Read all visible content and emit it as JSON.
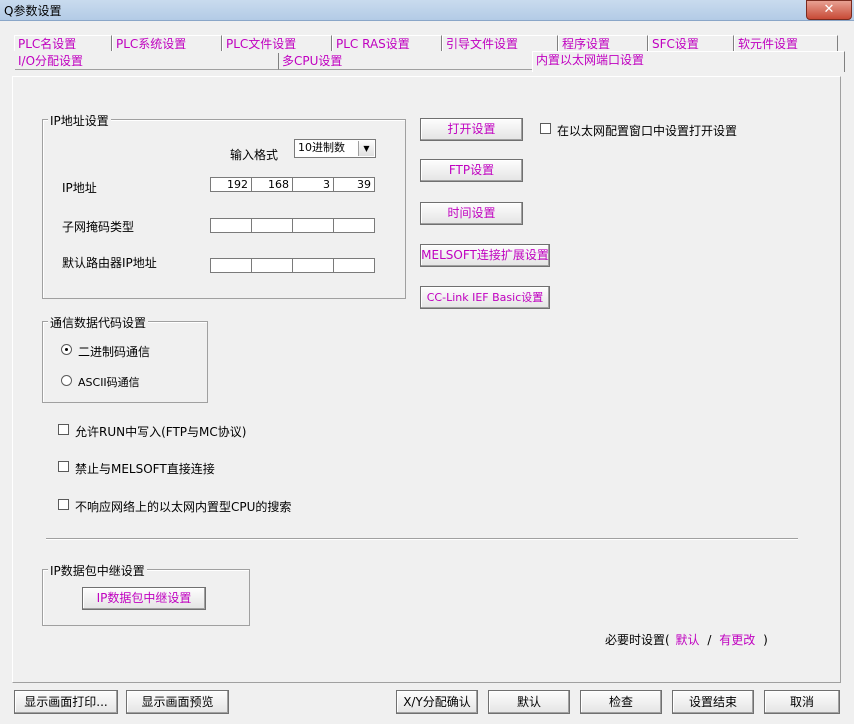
{
  "window": {
    "title": "Q参数设置",
    "close_glyph": "✕"
  },
  "tabs_row1": [
    "PLC名设置",
    "PLC系统设置",
    "PLC文件设置",
    "PLC RAS设置",
    "引导文件设置",
    "程序设置",
    "SFC设置",
    "软元件设置"
  ],
  "tabs_row2": [
    "I/O分配设置",
    "多CPU设置",
    "内置以太网端口设置"
  ],
  "ip_group": {
    "label": "IP地址设置",
    "input_format_label": "输入格式",
    "input_format_value": "10进制数",
    "ip_label": "IP地址",
    "ip": [
      "192",
      "168",
      "3",
      "39"
    ],
    "subnet_label": "子网掩码类型",
    "gateway_label": "默认路由器IP地址"
  },
  "side_buttons": {
    "open": "打开设置",
    "open_check": "在以太网配置窗口中设置打开设置",
    "ftp": "FTP设置",
    "time": "时间设置",
    "melsoft": "MELSOFT连接扩展设置",
    "cclink": "CC-Link IEF Basic设置"
  },
  "comm_group": {
    "label": "通信数据代码设置",
    "binary": "二进制码通信",
    "ascii": "ASCII码通信"
  },
  "options": {
    "allow_run_write": "允许RUN中写入(FTP与MC协议)",
    "forbid_melsoft": "禁止与MELSOFT直接连接",
    "no_respond_search": "不响应网络上的以太网内置型CPU的搜索"
  },
  "relay_group": {
    "label": "IP数据包中继设置",
    "button": "IP数据包中继设置"
  },
  "footer_note": {
    "prefix": "必要时设置(",
    "default": "默认",
    "sep": "/",
    "changed": "有更改",
    "suffix": ")"
  },
  "bottom_buttons": {
    "print": "显示画面打印...",
    "preview": "显示画面预览",
    "xy_confirm": "X/Y分配确认",
    "default": "默认",
    "check": "检查",
    "finish": "设置结束",
    "cancel": "取消"
  }
}
